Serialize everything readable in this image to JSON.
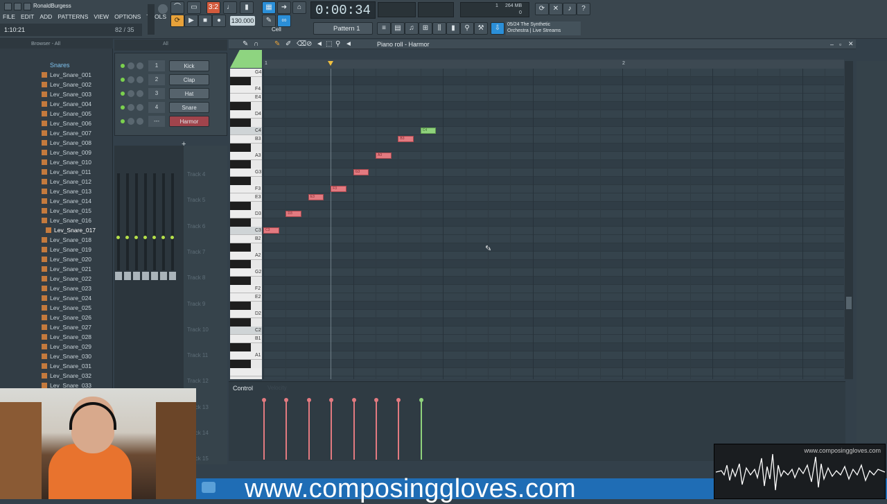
{
  "app": {
    "project_name": "RonaldBurgess",
    "hint_time": "1:10:21",
    "hint_count": "82 / 35"
  },
  "menu": [
    "FILE",
    "EDIT",
    "ADD",
    "PATTERNS",
    "VIEW",
    "OPTIONS",
    "TOOLS",
    "?"
  ],
  "transport": {
    "time": "0:00:34",
    "tempo": "130.000",
    "pattern": "Pattern 1",
    "snap": "Cell",
    "memory": "264 MB",
    "cpu_top": "1",
    "cpu_bottom": "0",
    "news_line1": "05/24  The Synthetic",
    "news_line2": "Orchestra | Live Streams",
    "bar_display": "3:2"
  },
  "browser": {
    "title": "Browser - All",
    "folder": "Snares",
    "items": [
      "Lev_Snare_001",
      "Lev_Snare_002",
      "Lev_Snare_003",
      "Lev_Snare_004",
      "Lev_Snare_005",
      "Lev_Snare_006",
      "Lev_Snare_007",
      "Lev_Snare_008",
      "Lev_Snare_009",
      "Lev_Snare_010",
      "Lev_Snare_011",
      "Lev_Snare_012",
      "Lev_Snare_013",
      "Lev_Snare_014",
      "Lev_Snare_015",
      "Lev_Snare_016",
      "Lev_Snare_017",
      "Lev_Snare_018",
      "Lev_Snare_019",
      "Lev_Snare_020",
      "Lev_Snare_021",
      "Lev_Snare_022",
      "Lev_Snare_023",
      "Lev_Snare_024",
      "Lev_Snare_025",
      "Lev_Snare_026",
      "Lev_Snare_027",
      "Lev_Snare_028",
      "Lev_Snare_029",
      "Lev_Snare_030",
      "Lev_Snare_031",
      "Lev_Snare_032",
      "Lev_Snare_033"
    ]
  },
  "channel_rack": {
    "filter": "All",
    "channels": [
      {
        "num": "1",
        "name": "Kick"
      },
      {
        "num": "2",
        "name": "Clap"
      },
      {
        "num": "3",
        "name": "Hat"
      },
      {
        "num": "4",
        "name": "Snare"
      },
      {
        "num": "---",
        "name": "Harmor"
      }
    ]
  },
  "playlist_tracks": [
    "Track 4",
    "Track 5",
    "Track 6",
    "Track 7",
    "Track 8",
    "Track 9",
    "Track 10",
    "Track 11",
    "Track 12",
    "Track 13",
    "Track 14",
    "Track 15"
  ],
  "piano_roll": {
    "title": "Piano roll - Harmor",
    "bar_markers": [
      "1",
      "2"
    ],
    "key_labels": [
      "G4",
      "F4",
      "E4",
      "D4",
      "C4",
      "B3",
      "A3",
      "G3",
      "F3",
      "E3",
      "D3",
      "C3",
      "B2",
      "A2",
      "G2",
      "F2",
      "E2",
      "D2",
      "C2",
      "B1",
      "A1"
    ],
    "notes": [
      {
        "label": "C3",
        "step": 0,
        "pitch": "C3",
        "selected": false
      },
      {
        "label": "D3",
        "step": 1,
        "pitch": "D3",
        "selected": false
      },
      {
        "label": "E3",
        "step": 2,
        "pitch": "E3",
        "selected": false
      },
      {
        "label": "F3",
        "step": 3,
        "pitch": "F3",
        "selected": false
      },
      {
        "label": "G3",
        "step": 4,
        "pitch": "G3",
        "selected": false
      },
      {
        "label": "A3",
        "step": 5,
        "pitch": "A3",
        "selected": false
      },
      {
        "label": "B3",
        "step": 6,
        "pitch": "B3",
        "selected": false
      },
      {
        "label": "C4",
        "step": 7,
        "pitch": "C4",
        "selected": true
      }
    ],
    "control_label": "Control",
    "control_target": "Velocity"
  },
  "overlay": {
    "banner_text": "www.composinggloves.com",
    "watermark_url": "www.composinggloves.com"
  },
  "colors": {
    "note": "#e37a80",
    "note_selected": "#8fd27c",
    "banner": "#1f6db5"
  }
}
